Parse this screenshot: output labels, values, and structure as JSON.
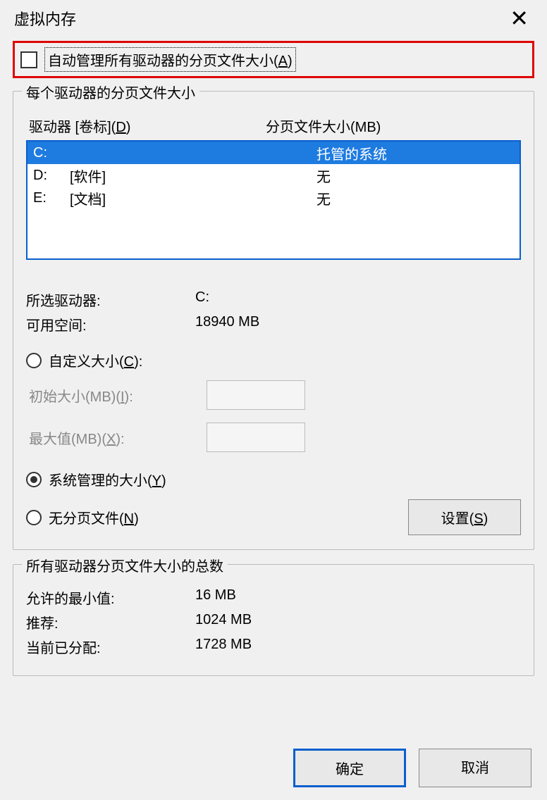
{
  "window": {
    "title": "虚拟内存"
  },
  "auto_manage": {
    "label": "自动管理所有驱动器的分页文件大小(A)",
    "checked": false
  },
  "group1": {
    "legend": "每个驱动器的分页文件大小",
    "header_drive": "驱动器 [卷标](D)",
    "header_size": "分页文件大小(MB)",
    "drives": [
      {
        "letter": "C:",
        "label": "",
        "size": "托管的系统",
        "selected": true
      },
      {
        "letter": "D:",
        "label": "[软件]",
        "size": "无",
        "selected": false
      },
      {
        "letter": "E:",
        "label": "[文档]",
        "size": "无",
        "selected": false
      }
    ],
    "selected_drive_label": "所选驱动器:",
    "selected_drive_value": "C:",
    "free_space_label": "可用空间:",
    "free_space_value": "18940 MB",
    "radio_custom": "自定义大小(C):",
    "initial_size_label": "初始大小(MB)(I):",
    "max_size_label": "最大值(MB)(X):",
    "radio_system": "系统管理的大小(Y)",
    "radio_none": "无分页文件(N)",
    "set_button": "设置(S)"
  },
  "group2": {
    "legend": "所有驱动器分页文件大小的总数",
    "min_label": "允许的最小值:",
    "min_value": "16 MB",
    "rec_label": "推荐:",
    "rec_value": "1024 MB",
    "cur_label": "当前已分配:",
    "cur_value": "1728 MB"
  },
  "buttons": {
    "ok": "确定",
    "cancel": "取消"
  }
}
